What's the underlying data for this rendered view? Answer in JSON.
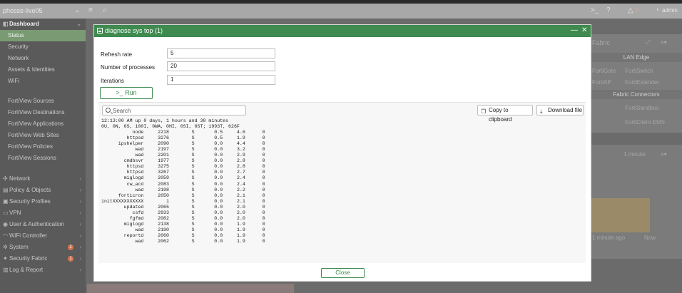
{
  "topbar": {
    "hostname": "phosse-live05",
    "badge_count": "2",
    "user": "admin"
  },
  "sidebar": {
    "dashboard_label": "Dashboard",
    "items": [
      {
        "label": "Status"
      },
      {
        "label": "Security"
      },
      {
        "label": "Network"
      },
      {
        "label": "Assets & Identities"
      },
      {
        "label": "WiFi"
      },
      {
        "label": "FortiView Sources"
      },
      {
        "label": "FortiView Destinations"
      },
      {
        "label": "FortiView Applications"
      },
      {
        "label": "FortiView Web Sites"
      },
      {
        "label": "FortiView Policies"
      },
      {
        "label": "FortiView Sessions"
      },
      {
        "label": "Network"
      },
      {
        "label": "Policy & Objects"
      },
      {
        "label": "Security Profiles"
      },
      {
        "label": "VPN"
      },
      {
        "label": "User & Authentication"
      },
      {
        "label": "WiFi Controller"
      },
      {
        "label": "System",
        "badge": "1"
      },
      {
        "label": "Security Fabric",
        "badge": "1"
      },
      {
        "label": "Log & Report"
      }
    ]
  },
  "background": {
    "fabric_title": "Fabric",
    "lan_edge": "LAN Edge",
    "fortigate": "FortiGate",
    "fortiswitch": "FortiSwitch",
    "fortiap": "FortiAP",
    "fortiextender": "FortiExtender",
    "fabric_connectors": "Fabric Connectors",
    "fortisandbox": "FortiSandbox",
    "forticlient_ems": "FortiClient EMS",
    "interval": "1 minute",
    "x_label_left": "1 minute ago",
    "x_label_right": "Now"
  },
  "modal": {
    "title": "diagnose sys top (1)",
    "refresh_rate_label": "Refresh rate",
    "refresh_rate_value": "5",
    "num_processes_label": "Number of processes",
    "num_processes_value": "20",
    "iterations_label": "Iterations",
    "iterations_value": "1",
    "run_label": ">_ Run",
    "search_placeholder": "Search",
    "copy_label": "Copy to clipboard",
    "download_label": "Download file",
    "close_label": "Close"
  },
  "output": {
    "header_line1": "12:13:00 AM up 0 days, 1 hours and 38 minutes",
    "header_line2": "0U, 0N, 0S, 100I, 0WA, 0HI, 0SI, 0ST; 1993T, 626F",
    "processes": [
      {
        "name": "node",
        "pid": "2218",
        "state": "S",
        "cpu": "0.5",
        "mem": "4.6",
        "cpu_no": "0"
      },
      {
        "name": "httpsd",
        "pid": "3276",
        "state": "S",
        "cpu": "0.5",
        "mem": "1.9",
        "cpu_no": "0"
      },
      {
        "name": "ipshelper",
        "pid": "2090",
        "state": "S",
        "cpu": "0.0",
        "mem": "4.4",
        "cpu_no": "0"
      },
      {
        "name": "wad",
        "pid": "2197",
        "state": "S",
        "cpu": "0.0",
        "mem": "3.2",
        "cpu_no": "0"
      },
      {
        "name": "wad",
        "pid": "2201",
        "state": "S",
        "cpu": "0.0",
        "mem": "2.9",
        "cpu_no": "0"
      },
      {
        "name": "cmdbsvr",
        "pid": "1977",
        "state": "S",
        "cpu": "0.0",
        "mem": "2.8",
        "cpu_no": "0"
      },
      {
        "name": "httpsd",
        "pid": "3275",
        "state": "S",
        "cpu": "0.0",
        "mem": "2.8",
        "cpu_no": "0"
      },
      {
        "name": "httpsd",
        "pid": "3267",
        "state": "S",
        "cpu": "0.0",
        "mem": "2.7",
        "cpu_no": "0"
      },
      {
        "name": "miglogd",
        "pid": "2059",
        "state": "S",
        "cpu": "0.0",
        "mem": "2.4",
        "cpu_no": "0"
      },
      {
        "name": "cw_acd",
        "pid": "2083",
        "state": "S",
        "cpu": "0.0",
        "mem": "2.4",
        "cpu_no": "0"
      },
      {
        "name": "wad",
        "pid": "2198",
        "state": "S",
        "cpu": "0.0",
        "mem": "2.2",
        "cpu_no": "0"
      },
      {
        "name": "forticron",
        "pid": "2050",
        "state": "S",
        "cpu": "0.0",
        "mem": "2.1",
        "cpu_no": "0"
      },
      {
        "name": "initXXXXXXXXXXX",
        "pid": "1",
        "state": "S",
        "cpu": "0.0",
        "mem": "2.1",
        "cpu_no": "0"
      },
      {
        "name": "updated",
        "pid": "2065",
        "state": "S",
        "cpu": "0.0",
        "mem": "2.0",
        "cpu_no": "0"
      },
      {
        "name": "csfd",
        "pid": "2933",
        "state": "S",
        "cpu": "0.0",
        "mem": "2.0",
        "cpu_no": "0"
      },
      {
        "name": "fgfmd",
        "pid": "2082",
        "state": "S",
        "cpu": "0.0",
        "mem": "2.0",
        "cpu_no": "0"
      },
      {
        "name": "miglogd",
        "pid": "2138",
        "state": "S",
        "cpu": "0.0",
        "mem": "1.9",
        "cpu_no": "0"
      },
      {
        "name": "wad",
        "pid": "2190",
        "state": "S",
        "cpu": "0.0",
        "mem": "1.9",
        "cpu_no": "0"
      },
      {
        "name": "reportd",
        "pid": "2060",
        "state": "S",
        "cpu": "0.0",
        "mem": "1.9",
        "cpu_no": "0"
      },
      {
        "name": "wad",
        "pid": "2062",
        "state": "S",
        "cpu": "0.0",
        "mem": "1.9",
        "cpu_no": "0"
      }
    ]
  }
}
